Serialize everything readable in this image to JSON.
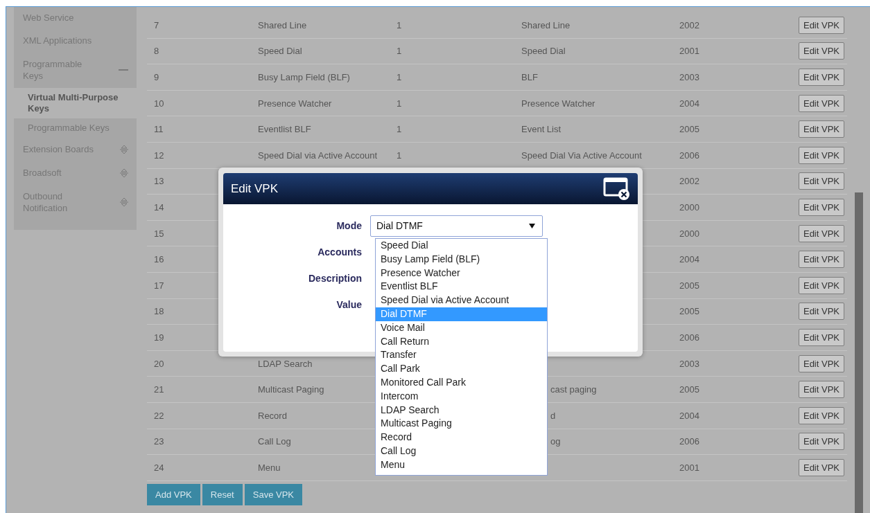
{
  "sidebar": {
    "items": [
      {
        "label": "Web Service",
        "kind": "page"
      },
      {
        "label": "XML Applications",
        "kind": "page"
      },
      {
        "label": "Programmable Keys",
        "kind": "group",
        "expanded": true,
        "children": [
          {
            "label": "Virtual Multi-Purpose Keys",
            "selected": true
          },
          {
            "label": "Programmable Keys",
            "selected": false
          }
        ]
      },
      {
        "label": "Extension Boards",
        "kind": "group",
        "expanded": false
      },
      {
        "label": "Broadsoft",
        "kind": "group",
        "expanded": false
      },
      {
        "label": "Outbound Notification",
        "kind": "group",
        "expanded": false
      }
    ]
  },
  "table": {
    "rows": [
      {
        "index": "7",
        "mode": "Shared Line",
        "accounts": "1",
        "description": "Shared Line",
        "value": "2002",
        "action": "Edit VPK"
      },
      {
        "index": "8",
        "mode": "Speed Dial",
        "accounts": "1",
        "description": "Speed Dial",
        "value": "2001",
        "action": "Edit VPK"
      },
      {
        "index": "9",
        "mode": "Busy Lamp Field (BLF)",
        "accounts": "1",
        "description": "BLF",
        "value": "2003",
        "action": "Edit VPK"
      },
      {
        "index": "10",
        "mode": "Presence Watcher",
        "accounts": "1",
        "description": "Presence Watcher",
        "value": "2004",
        "action": "Edit VPK"
      },
      {
        "index": "11",
        "mode": "Eventlist BLF",
        "accounts": "1",
        "description": "Event List",
        "value": "2005",
        "action": "Edit VPK"
      },
      {
        "index": "12",
        "mode": "Speed Dial via Active Account",
        "accounts": "1",
        "description": "Speed Dial Via Active Account",
        "value": "2006",
        "action": "Edit VPK"
      },
      {
        "index": "13",
        "value": "2002",
        "action": "Edit VPK"
      },
      {
        "index": "14",
        "value": "2000",
        "action": "Edit VPK"
      },
      {
        "index": "15",
        "value": "2000",
        "action": "Edit VPK"
      },
      {
        "index": "16",
        "value": "2004",
        "action": "Edit VPK"
      },
      {
        "index": "17",
        "value": "2005",
        "action": "Edit VPK"
      },
      {
        "index": "18",
        "value": "2005",
        "action": "Edit VPK"
      },
      {
        "index": "19",
        "value": "2006",
        "action": "Edit VPK"
      },
      {
        "index": "20",
        "mode": "LDAP Search",
        "value": "2003",
        "action": "Edit VPK"
      },
      {
        "index": "21",
        "mode": "Multicast Paging",
        "description_tail": "cast paging",
        "value": "2005",
        "action": "Edit VPK"
      },
      {
        "index": "22",
        "mode": "Record",
        "description_tail": "d",
        "value": "2004",
        "action": "Edit VPK"
      },
      {
        "index": "23",
        "mode": "Call Log",
        "description_tail": "og",
        "value": "2006",
        "action": "Edit VPK"
      },
      {
        "index": "24",
        "mode": "Menu",
        "value": "2001",
        "action": "Edit VPK"
      }
    ]
  },
  "buttons": [
    "Add VPK",
    "Reset",
    "Save VPK"
  ],
  "dialog": {
    "title": "Edit VPK",
    "fields": [
      {
        "label": "Mode",
        "kind": "select",
        "value": "Dial DTMF"
      },
      {
        "label": "Accounts",
        "kind": "hidden"
      },
      {
        "label": "Description",
        "kind": "hidden"
      },
      {
        "label": "Value",
        "kind": "hidden"
      }
    ],
    "dropdown": {
      "options": [
        {
          "label": "Speed Dial",
          "selected": false
        },
        {
          "label": "Busy Lamp Field (BLF)",
          "selected": false
        },
        {
          "label": "Presence Watcher",
          "selected": false
        },
        {
          "label": "Eventlist BLF",
          "selected": false
        },
        {
          "label": "Speed Dial via Active Account",
          "selected": false
        },
        {
          "label": "Dial DTMF",
          "selected": true
        },
        {
          "label": "Voice Mail",
          "selected": false
        },
        {
          "label": "Call Return",
          "selected": false
        },
        {
          "label": "Transfer",
          "selected": false
        },
        {
          "label": "Call Park",
          "selected": false
        },
        {
          "label": "Monitored Call Park",
          "selected": false
        },
        {
          "label": "Intercom",
          "selected": false
        },
        {
          "label": "LDAP Search",
          "selected": false
        },
        {
          "label": "Multicast Paging",
          "selected": false
        },
        {
          "label": "Record",
          "selected": false
        },
        {
          "label": "Call Log",
          "selected": false
        },
        {
          "label": "Menu",
          "selected": false
        }
      ]
    }
  }
}
